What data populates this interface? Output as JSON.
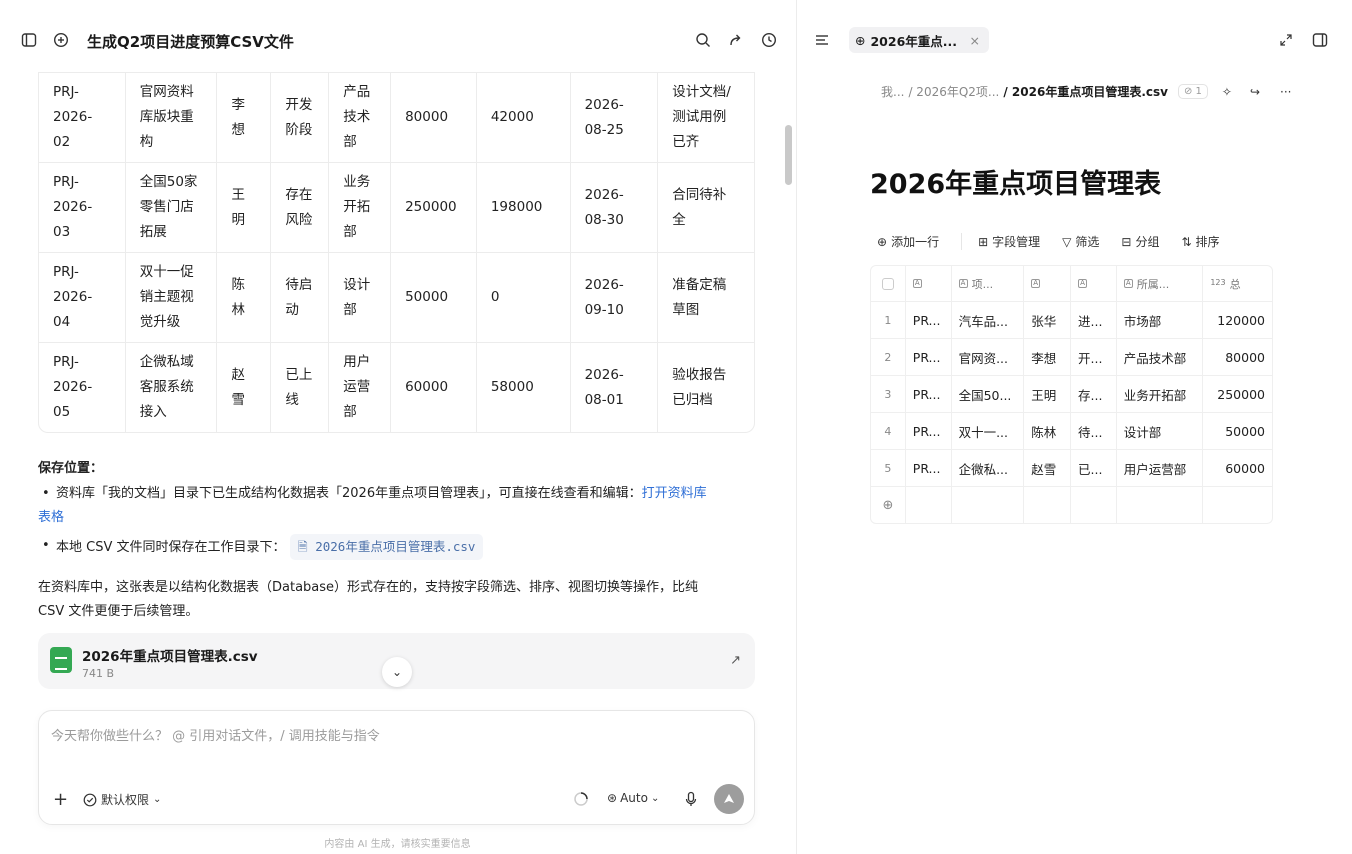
{
  "left": {
    "title": "生成Q2项目进度预算CSV文件",
    "rows": [
      [
        "PRJ-\n2026-\n02",
        "官网资料\n库版块重\n构",
        "李\n想",
        "开发\n阶段",
        "产品\n技术\n部",
        "80000",
        "42000",
        "2026-\n08-25",
        "设计文档/\n测试用例\n已齐"
      ],
      [
        "PRJ-\n2026-\n03",
        "全国50家\n零售门店\n拓展",
        "王\n明",
        "存在\n风险",
        "业务\n开拓\n部",
        "250000",
        "198000",
        "2026-\n08-30",
        "合同待补\n全"
      ],
      [
        "PRJ-\n2026-\n04",
        "双十一促\n销主题视\n觉升级",
        "陈\n林",
        "待启\n动",
        "设计\n部",
        "50000",
        "0",
        "2026-\n09-10",
        "准备定稿\n草图"
      ],
      [
        "PRJ-\n2026-\n05",
        "企微私域\n客服系统\n接入",
        "赵\n雪",
        "已上\n线",
        "用户\n运营\n部",
        "60000",
        "58000",
        "2026-\n08-01",
        "验收报告\n已归档"
      ]
    ],
    "save_heading": "保存位置：",
    "bullet1_text": "资料库「我的文档」目录下已生成结构化数据表「2026年重点项目管理表」，可直接在线查看和编辑：",
    "bullet1_link_a": "打开资料库",
    "bullet1_link_b": "表格",
    "bullet2_text": "本地 CSV 文件同时保存在工作目录下：",
    "bullet2_chip": "2026年重点项目管理表.csv",
    "para1": "在资料库中，这张表是以结构化数据表（Database）形式存在的，支持按字段筛选、排序、视图切换等操作，比纯",
    "para2": "CSV 文件更便于后续管理。",
    "file_name": "2026年重点项目管理表.csv",
    "file_size": "741 B",
    "placeholder": "今天帮你做些什么？ @ 引用对话文件，/ 调用技能与指令",
    "permission": "默认权限",
    "model": "Auto",
    "footer": "内容由 AI 生成，请核实重要信息"
  },
  "right": {
    "tab_label": "2026年重点...",
    "crumb1": "我...",
    "crumb2": "/ 2026年Q2项...",
    "crumb3": "/ 2026年重点项目管理表.csv",
    "badge": "1",
    "doc_title": "2026年重点项目管理表",
    "toolbar": [
      "添加一行",
      "字段管理",
      "筛选",
      "分组",
      "排序"
    ],
    "headers": [
      "",
      "",
      "项...",
      "",
      "",
      "所属...",
      "总"
    ],
    "rows": [
      [
        "1",
        "PR...",
        "汽车品...",
        "张华",
        "进...",
        "市场部",
        "120000"
      ],
      [
        "2",
        "PR...",
        "官网资...",
        "李想",
        "开...",
        "产品技术部",
        "80000"
      ],
      [
        "3",
        "PR...",
        "全国50...",
        "王明",
        "存...",
        "业务开拓部",
        "250000"
      ],
      [
        "4",
        "PR...",
        "双十一...",
        "陈林",
        "待...",
        "设计部",
        "50000"
      ],
      [
        "5",
        "PR...",
        "企微私...",
        "赵雪",
        "已...",
        "用户运营部",
        "60000"
      ]
    ]
  }
}
